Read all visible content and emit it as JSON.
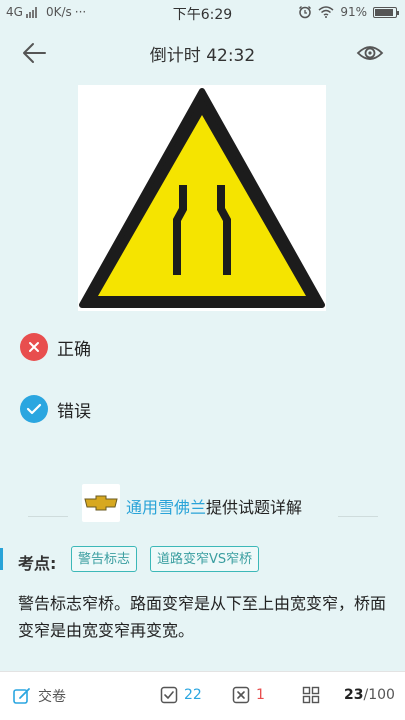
{
  "status_bar": {
    "network": "4G",
    "speed": "0K/s",
    "dots": "···",
    "time": "下午6:29",
    "battery": "91%",
    "battery_level": 0.91
  },
  "header": {
    "title": "倒计时 42:32"
  },
  "question": {
    "image": "narrow-road-warning-sign",
    "options": [
      {
        "label": "正确",
        "state": "wrong",
        "color": "#e84e4e"
      },
      {
        "label": "错误",
        "state": "correct",
        "color": "#2ba6e0"
      }
    ]
  },
  "provider": {
    "brand": "通用雪佛兰",
    "suffix": "提供试题详解"
  },
  "keypoints": {
    "label": "考点:",
    "tags": [
      "警告标志",
      "道路变窄VS窄桥"
    ]
  },
  "explanation": "警告标志窄桥。路面变窄是从下至上由宽变窄，桥面变窄是由宽变窄再变宽。",
  "bottom_bar": {
    "submit_label": "交卷",
    "correct_count": "22",
    "wrong_count": "1",
    "progress_current": "23",
    "progress_total": "/100",
    "accent_blue": "#2ba6e0",
    "accent_red": "#e84e4e"
  }
}
